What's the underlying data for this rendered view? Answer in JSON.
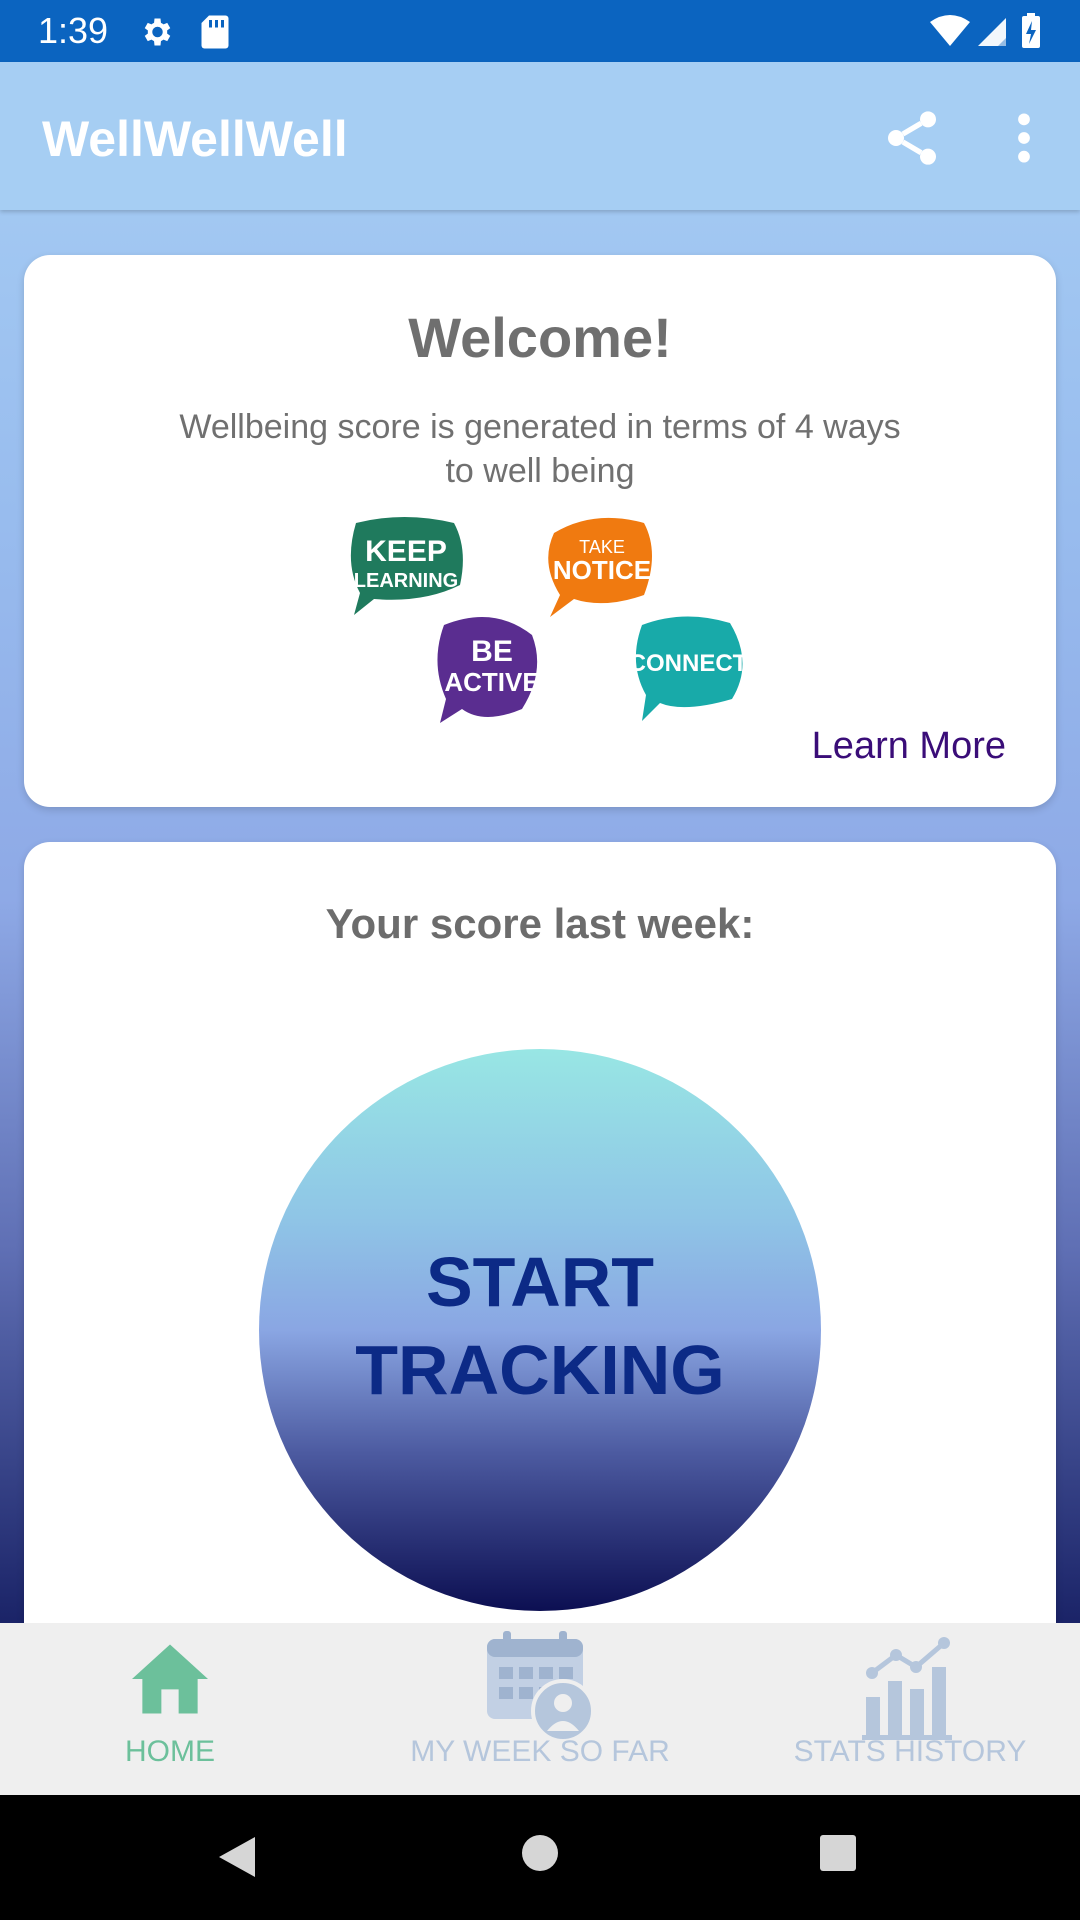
{
  "status_bar": {
    "time": "1:39",
    "icons": [
      "gear-icon",
      "sd-card-icon",
      "wifi-icon",
      "signal-icon",
      "battery-charging-icon"
    ]
  },
  "app_bar": {
    "title": "WellWellWell",
    "actions": [
      "share-icon",
      "more-vert-icon"
    ]
  },
  "welcome_card": {
    "title": "Welcome!",
    "description": "Wellbeing score is generated in terms of 4 ways to well being",
    "bubbles": [
      {
        "text_line1": "KEEP",
        "text_line2": "LEARNING",
        "color": "#1f7a5d"
      },
      {
        "text_line1": "TAKE",
        "text_line2": "NOTICE",
        "color": "#f07a10"
      },
      {
        "text_line1": "BE",
        "text_line2": "ACTIVE",
        "color": "#5a2d90"
      },
      {
        "text_line1": "CONNECT",
        "text_line2": "",
        "color": "#18aaa9"
      }
    ],
    "learn_more": "Learn More"
  },
  "score_card": {
    "title": "Your score last week:",
    "button_line1": "START",
    "button_line2": "TRACKING"
  },
  "bottom_nav": {
    "items": [
      {
        "label": "HOME",
        "icon": "home-icon",
        "active": true
      },
      {
        "label": "MY WEEK SO FAR",
        "icon": "calendar-user-icon",
        "active": false
      },
      {
        "label": "STATS HISTORY",
        "icon": "bar-chart-icon",
        "active": false
      }
    ],
    "active_color": "#6cc09b",
    "inactive_color": "#b5c6dc"
  },
  "system_nav": {
    "icons": [
      "back-icon",
      "home-circle-icon",
      "recents-icon"
    ]
  }
}
